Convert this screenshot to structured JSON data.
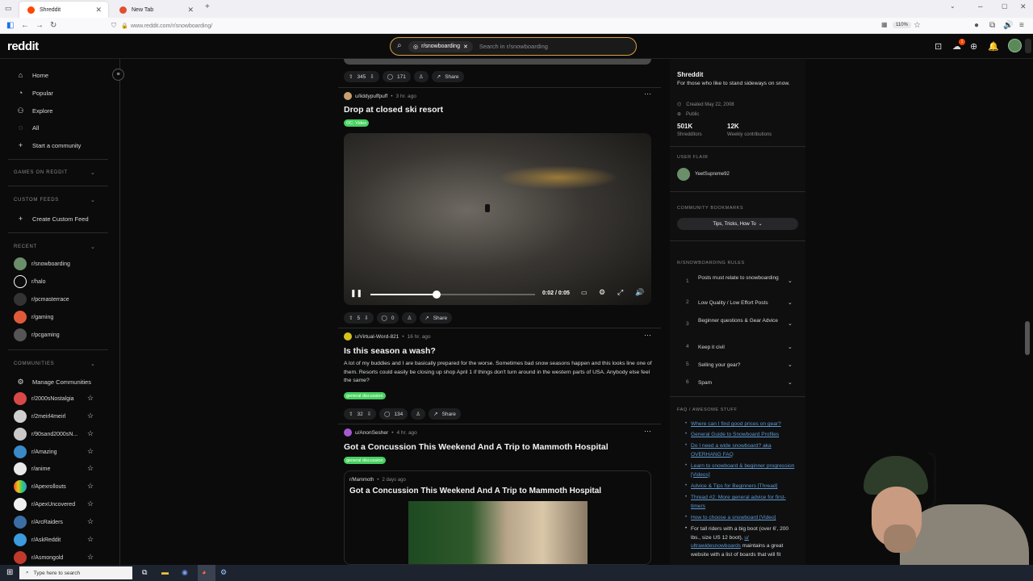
{
  "browser": {
    "tabs": [
      {
        "title": "Shreddit",
        "active": true
      },
      {
        "title": "New Tab",
        "active": false
      }
    ],
    "url": "www.reddit.com/r/snowboarding/",
    "zoom": "110%"
  },
  "header": {
    "logo": "reddit",
    "search_chip": "r/snowboarding",
    "search_placeholder": "Search in r/snowboarding",
    "chat_badge": "1"
  },
  "sidebar": {
    "nav": [
      {
        "label": "Home",
        "icon": "home-icon"
      },
      {
        "label": "Popular",
        "icon": "popular-icon"
      },
      {
        "label": "Explore",
        "icon": "explore-icon"
      },
      {
        "label": "All",
        "icon": "all-icon"
      },
      {
        "label": "Start a community",
        "icon": "plus-icon"
      }
    ],
    "games_heading": "GAMES ON REDDIT",
    "custom_feeds_heading": "CUSTOM FEEDS",
    "create_custom_feed": "Create Custom Feed",
    "recent_heading": "RECENT",
    "recent": [
      {
        "name": "r/snowboarding",
        "color": "#6b8e6b"
      },
      {
        "name": "r/halo",
        "color": "#ffffff"
      },
      {
        "name": "r/pcmasterrace",
        "color": "#ffffff"
      },
      {
        "name": "r/gaming",
        "color": "#e05a3a"
      },
      {
        "name": "r/pcgaming",
        "color": "#ffffff"
      }
    ],
    "communities_heading": "COMMUNITIES",
    "manage_communities": "Manage Communities",
    "communities": [
      {
        "name": "r/2000sNostalgia",
        "color": "#d94848"
      },
      {
        "name": "r/2meirl4meirl",
        "color": "#cfcfcf"
      },
      {
        "name": "r/90sand2000sN...",
        "color": "#c9c9c9"
      },
      {
        "name": "r/Amazing",
        "color": "#3a8ac7"
      },
      {
        "name": "r/anime",
        "color": "#e8e8e8"
      },
      {
        "name": "r/Apexrollouts",
        "color": "#e67e22"
      },
      {
        "name": "r/ApexUncovered",
        "color": "#f0f0f0"
      },
      {
        "name": "r/ArcRaiders",
        "color": "#3a6ea5"
      },
      {
        "name": "r/AskReddit",
        "color": "#3b9bdb"
      },
      {
        "name": "r/Asmongold",
        "color": "#c0392b"
      }
    ]
  },
  "feed": {
    "post0_bar": {
      "votes": "345",
      "comments": "171",
      "share": "Share"
    },
    "post1": {
      "author": "u/liddypuffpuff",
      "time": "3 hr. ago",
      "title": "Drop at closed ski resort",
      "flair": "OC: Video",
      "flair_color": "#46d160",
      "video_time": "0:02 / 0:05",
      "video_progress": 0.4,
      "votes": "5",
      "comments": "0",
      "share": "Share"
    },
    "post2": {
      "author": "u/Virtual-Word-821",
      "time": "16 hr. ago",
      "title": "Is this season a wash?",
      "body": "A lot of my buddies and I are basically prepared for the worse. Sometimes bad snow seasons happen and this looks line one of them. Resorts could easily be closing up shop April 1 if things don't turn around in the western parts of USA. Anybody else feel the same?",
      "flair": "general discussion",
      "flair_color": "#46d160",
      "votes": "32",
      "comments": "134",
      "share": "Share"
    },
    "post3": {
      "author": "u/AnonSesher",
      "time": "4 hr. ago",
      "title": "Got a Concussion This Weekend And A Trip to Mammoth Hospital",
      "flair": "general discussion",
      "flair_color": "#46d160",
      "crosspost_sub": "r/Mammoth",
      "crosspost_time": "2 days ago",
      "crosspost_title": "Got a Concussion This Weekend And A Trip to Mammoth Hospital"
    }
  },
  "right": {
    "title": "Shreddit",
    "desc": "For those who like to stand sideways on snow.",
    "created": "Created May 22, 2008",
    "visibility": "Public",
    "stat1_value": "501K",
    "stat1_label": "Shredditors",
    "stat2_value": "12K",
    "stat2_label": "Weekly contributions",
    "user_flair_heading": "USER FLAIR",
    "user_flair_name": "YeetSupreme92",
    "bookmarks_heading": "COMMUNITY BOOKMARKS",
    "bookmark_button": "Tips, Tricks, How To",
    "rules_heading": "R/SNOWBOARDING RULES",
    "rules": [
      {
        "num": "1",
        "text": "Posts must relate to snowboarding"
      },
      {
        "num": "2",
        "text": "Low Quality / Low Effort Posts"
      },
      {
        "num": "3",
        "text": "Beginner questions & Gear Advice"
      },
      {
        "num": "4",
        "text": "Keep it civil"
      },
      {
        "num": "5",
        "text": "Selling your gear?"
      },
      {
        "num": "6",
        "text": "Spam"
      }
    ],
    "faq_heading": "FAQ / AWESOME STUFF",
    "faq": [
      "Where can I find good prices on gear?",
      "General Guide to Snowboard Profiles",
      "Do I need a wide snowboard? aka OVERHANG FAQ",
      "Learn to snowboard & beginner progression [Videos]",
      "Advice & Tips for Beginners [Thread]",
      "Thread #2: More general advice for first-timers",
      "How to choose a snowboard [Video]"
    ],
    "faq_tail_pre": "For tall riders with a big boot (over 6', 200 lbs., size US 12 boot), ",
    "faq_tail_link": "u/ ultrawidesnowboards",
    "faq_tail_post": " maintains a great website with a list of boards that will fit"
  },
  "taskbar": {
    "search_placeholder": "Type here to search"
  }
}
